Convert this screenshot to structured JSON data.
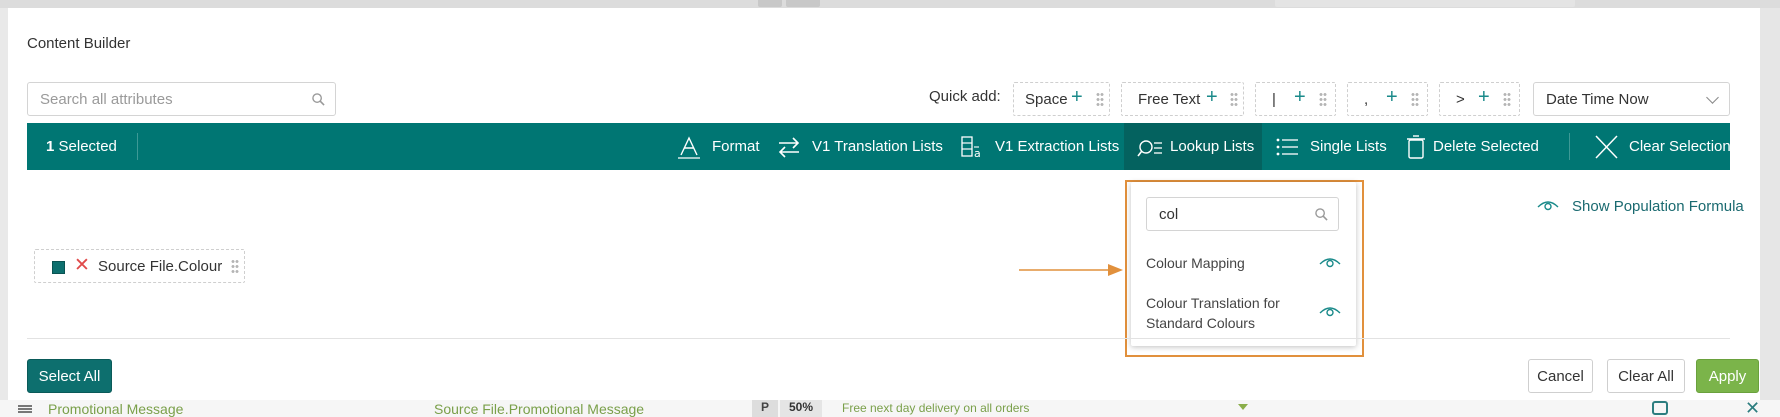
{
  "dialog": {
    "title": "Content Builder",
    "search": {
      "placeholder": "Search all attributes"
    },
    "quick_add": {
      "label": "Quick add:",
      "items": [
        {
          "label": "Space"
        },
        {
          "label": "Free Text"
        },
        {
          "label": "|"
        },
        {
          "label": ","
        },
        {
          "label": ">"
        }
      ],
      "date_select": "Date Time Now"
    },
    "toolbar": {
      "selected_count": "1",
      "selected_label": "Selected",
      "items": [
        {
          "label": "Format",
          "icon": "format-icon"
        },
        {
          "label": "V1 Translation Lists",
          "icon": "swap-arrows-icon"
        },
        {
          "label": "V1 Extraction Lists",
          "icon": "extraction-icon"
        },
        {
          "label": "Lookup Lists",
          "icon": "lookup-search-icon",
          "active": true
        },
        {
          "label": "Single Lists",
          "icon": "list-icon"
        },
        {
          "label": "Delete Selected",
          "icon": "trash-icon"
        },
        {
          "label": "Clear Selection",
          "icon": "close-icon"
        }
      ]
    },
    "show_formula": "Show Population Formula",
    "attribute_chip": "Source File.Colour",
    "lookup_dropdown": {
      "search_value": "col",
      "items": [
        {
          "label": "Colour Mapping"
        },
        {
          "label": "Colour Translation for Standard Colours"
        }
      ]
    },
    "buttons": {
      "select_all": "Select All",
      "cancel": "Cancel",
      "clear_all": "Clear All",
      "apply": "Apply"
    }
  },
  "background_row": {
    "name": "Promotional Message",
    "source": "Source File.Promotional Message",
    "p": "P",
    "percent": "50%",
    "message": "Free next day delivery on all orders"
  },
  "colors": {
    "teal": "#007673",
    "apply_green": "#7bb44a",
    "highlight_orange": "#e1903c"
  }
}
